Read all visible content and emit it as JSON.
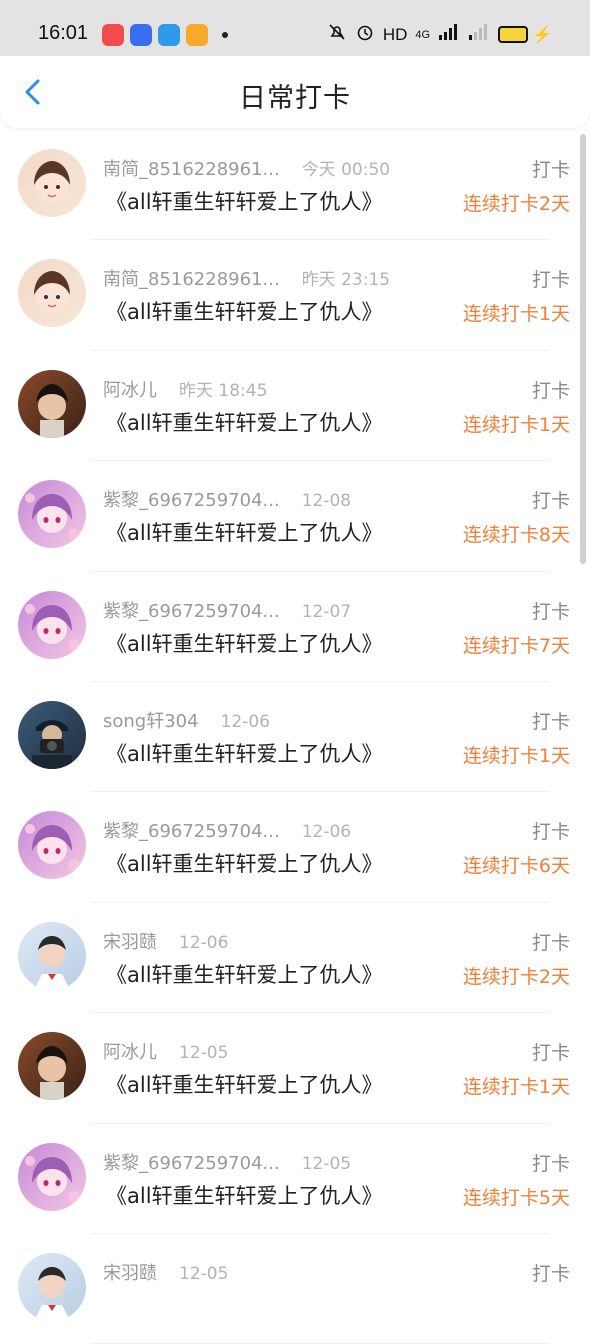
{
  "status_bar": {
    "time": "16:01",
    "app_icons": [
      {
        "name": "music-app-icon",
        "color": "#f24b4b"
      },
      {
        "name": "baidu-app-icon",
        "color": "#3a6ef0"
      },
      {
        "name": "browser-app-icon",
        "color": "#2f9be8"
      },
      {
        "name": "gallery-app-icon",
        "color": "#f7a92b"
      }
    ],
    "network_label": "HD",
    "network_type": "4G",
    "battery_color": "#f7d43a"
  },
  "header": {
    "title": "日常打卡",
    "back_icon": "chevron-left-icon",
    "accent_color": "#2f8ce8"
  },
  "colors": {
    "streak": "#f0803a",
    "username": "#9a9a9a"
  },
  "entries": [
    {
      "username": "南简_8516228961...",
      "time": "今天 00:50",
      "book": "《all轩重生轩轩爱上了仇人》",
      "tag": "打卡",
      "streak": "连续打卡2天",
      "avatar": "girl-avatar"
    },
    {
      "username": "南简_8516228961...",
      "time": "昨天 23:15",
      "book": "《all轩重生轩轩爱上了仇人》",
      "tag": "打卡",
      "streak": "连续打卡1天",
      "avatar": "girl-avatar"
    },
    {
      "username": "阿冰儿",
      "time": "昨天 18:45",
      "book": "《all轩重生轩轩爱上了仇人》",
      "tag": "打卡",
      "streak": "连续打卡1天",
      "avatar": "boy-avatar"
    },
    {
      "username": "紫黎_6967259704...",
      "time": "12-08",
      "book": "《all轩重生轩轩爱上了仇人》",
      "tag": "打卡",
      "streak": "连续打卡8天",
      "avatar": "anime-avatar"
    },
    {
      "username": "紫黎_6967259704...",
      "time": "12-07",
      "book": "《all轩重生轩轩爱上了仇人》",
      "tag": "打卡",
      "streak": "连续打卡7天",
      "avatar": "anime-avatar"
    },
    {
      "username": "song轩304",
      "time": "12-06",
      "book": "《all轩重生轩轩爱上了仇人》",
      "tag": "打卡",
      "streak": "连续打卡1天",
      "avatar": "camera-avatar"
    },
    {
      "username": "紫黎_6967259704...",
      "time": "12-06",
      "book": "《all轩重生轩轩爱上了仇人》",
      "tag": "打卡",
      "streak": "连续打卡6天",
      "avatar": "anime-avatar"
    },
    {
      "username": "宋羽赜",
      "time": "12-06",
      "book": "《all轩重生轩轩爱上了仇人》",
      "tag": "打卡",
      "streak": "连续打卡2天",
      "avatar": "student-avatar"
    },
    {
      "username": "阿冰儿",
      "time": "12-05",
      "book": "《all轩重生轩轩爱上了仇人》",
      "tag": "打卡",
      "streak": "连续打卡1天",
      "avatar": "boy-avatar"
    },
    {
      "username": "紫黎_6967259704...",
      "time": "12-05",
      "book": "《all轩重生轩轩爱上了仇人》",
      "tag": "打卡",
      "streak": "连续打卡5天",
      "avatar": "anime-avatar"
    },
    {
      "username": "宋羽赜",
      "time": "12-05",
      "book": "",
      "tag": "打卡",
      "streak": "",
      "avatar": "student-avatar"
    }
  ]
}
